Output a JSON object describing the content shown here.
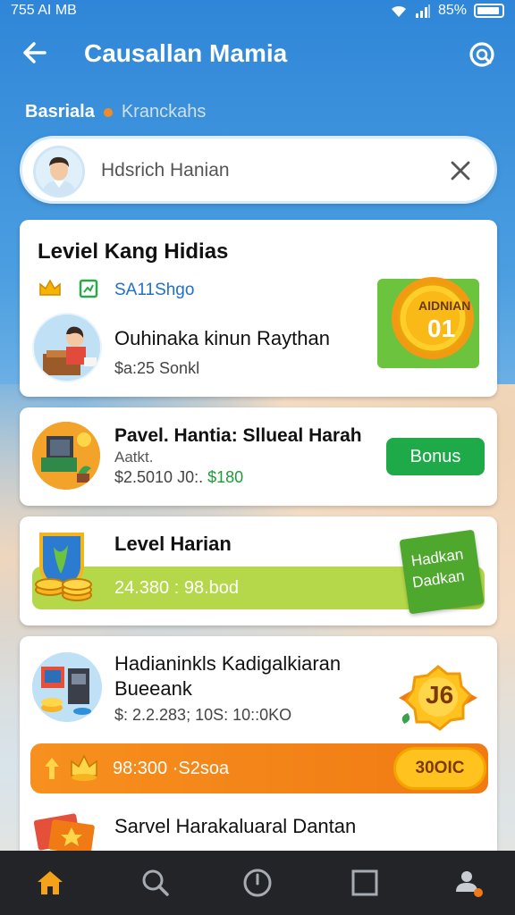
{
  "status": {
    "time": "755 AI MB",
    "battery": "85%"
  },
  "header": {
    "title": "Causallan Mamia"
  },
  "breadcrumb": {
    "primary": "Basriala",
    "secondary": "Kranckahs"
  },
  "search": {
    "value": "Hdsrich Hanian"
  },
  "cards": [
    {
      "title": "Leviel Kang Hidias",
      "tag": "SA11Shgo",
      "item_title": "Ouhinaka kinun Raythan",
      "item_sub": "$a:25 Sonkl",
      "badge_label": "AIDNIAN",
      "badge_number": "01"
    },
    {
      "title": "Pavel. Hantia: Sllueal Harah",
      "sub1": "Aatkt.",
      "sub2a": "$2.5010 J0:.",
      "sub2b": "$180",
      "button": "Bonus"
    },
    {
      "title": "Level Harian",
      "bar_text": "24.380 : 98.bod",
      "flag_line1": "Hadkan",
      "flag_line2": "Dadkan"
    },
    {
      "title_line1": "Hadianinkls Kadigalkiaran",
      "title_line2": "Bueeank",
      "sub": "$: 2.2.283; 10S: 10::0KO",
      "badge_number": "J6",
      "bar_text": "98:300 ·S2soa",
      "bar_button": "30OIC",
      "footer_title": "Sarvel Harakaluaral Dantan"
    }
  ],
  "nav": [
    "home-icon",
    "search-icon",
    "clock-icon",
    "square-icon",
    "profile-icon"
  ],
  "colors": {
    "accent": "#2f86d8",
    "green": "#1faa4a",
    "orange": "#f7901e",
    "lime": "#b5d84a",
    "gold": "#ffc21f"
  }
}
